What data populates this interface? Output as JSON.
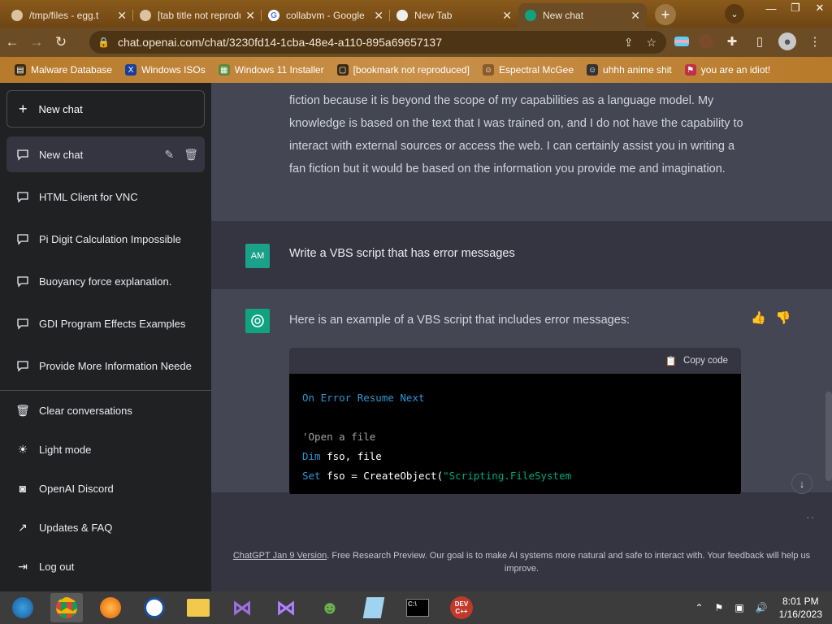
{
  "browser": {
    "tabs": [
      {
        "title": "/tmp/files - egg.t",
        "active": false
      },
      {
        "title": "[tab title not reproduced]",
        "active": false
      },
      {
        "title": "collabvm - Google",
        "active": false
      },
      {
        "title": "New Tab",
        "active": false
      },
      {
        "title": "New chat",
        "active": true
      }
    ],
    "url": "chat.openai.com/chat/3230fd14-1cba-48e4-a110-895a69657137",
    "bookmarks": [
      {
        "label": "Malware Database",
        "icon": "folder-icon"
      },
      {
        "label": "Windows ISOs",
        "icon": "x-icon"
      },
      {
        "label": "Windows 11 Installer",
        "icon": "image-icon"
      },
      {
        "label": "[bookmark not reproduced]",
        "icon": "page-icon"
      },
      {
        "label": "Espectral McGee",
        "icon": "avatar-icon"
      },
      {
        "label": "uhhh anime shit",
        "icon": "avatar-icon"
      },
      {
        "label": "you are an idiot!",
        "icon": "flag-icon"
      }
    ]
  },
  "sidebar": {
    "new_chat": "New chat",
    "conversations": [
      {
        "label": "New chat",
        "selected": true
      },
      {
        "label": "HTML Client for VNC",
        "selected": false
      },
      {
        "label": "Pi Digit Calculation Impossible",
        "selected": false
      },
      {
        "label": "Buoyancy force explanation.",
        "selected": false
      },
      {
        "label": "GDI Program Effects Examples",
        "selected": false
      },
      {
        "label": "Provide More Information Neede",
        "selected": false
      }
    ],
    "actions": [
      {
        "label": "Clear conversations",
        "icon": "trash-icon"
      },
      {
        "label": "Light mode",
        "icon": "sun-icon"
      },
      {
        "label": "OpenAI Discord",
        "icon": "discord-icon"
      },
      {
        "label": "Updates & FAQ",
        "icon": "external-link-icon"
      },
      {
        "label": "Log out",
        "icon": "logout-icon"
      }
    ]
  },
  "chat": {
    "previous_text": "fiction because it is beyond the scope of my capabilities as a language model. My knowledge is based on the text that I was trained on, and I do not have the capability to interact with external sources or access the web. I can certainly assist you in writing a fan fiction but it would be based on the information you provide me and imagination.",
    "user_initials": "AM",
    "user_message": "Write a VBS script that has error messages",
    "bot_message": "Here is an example of a VBS script that includes error messages:",
    "copy_code": "Copy code",
    "code_lines": {
      "l1": "On Error Resume Next",
      "l3": "'Open a file",
      "l4a": "Dim",
      "l4b": " fso, file",
      "l5a": "Set",
      "l5b": " fso = CreateObject(",
      "l5c": "\"Scripting.FileSystem"
    }
  },
  "footer": {
    "link": "ChatGPT Jan 9 Version",
    "text": ". Free Research Preview. Our goal is to make AI systems more natural and safe to interact with. Your feedback will help us improve."
  },
  "taskbar": {
    "time": "8:01 PM",
    "date": "1/16/2023"
  }
}
